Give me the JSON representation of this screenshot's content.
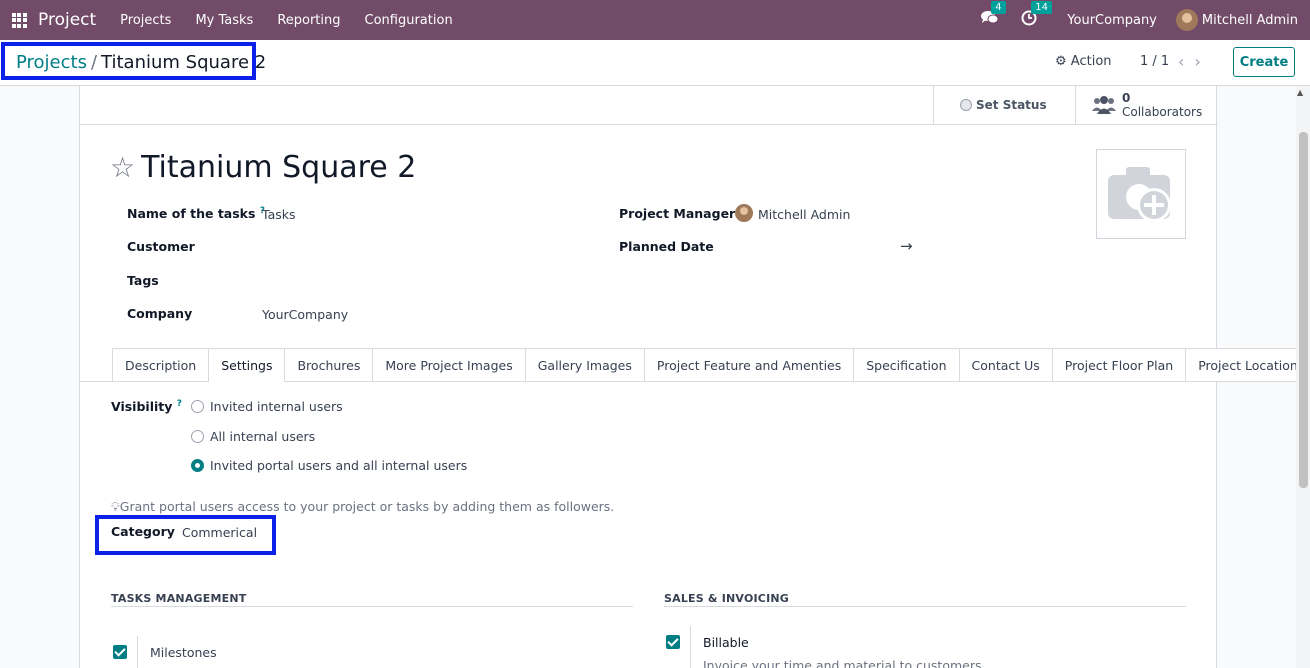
{
  "topbar": {
    "app_name": "Project",
    "menu": [
      "Projects",
      "My Tasks",
      "Reporting",
      "Configuration"
    ],
    "messages_count": "4",
    "activities_count": "14",
    "company": "YourCompany",
    "user": "Mitchell Admin"
  },
  "control": {
    "breadcrumb_parent": "Projects",
    "breadcrumb_sep": "/",
    "breadcrumb_current": "Titanium Square 2",
    "action_label": "Action",
    "pager": "1 / 1",
    "create_label": "Create"
  },
  "buttonbox": {
    "set_status": "Set Status",
    "collaborators_count": "0",
    "collaborators_label": "Collaborators"
  },
  "form": {
    "title": "Titanium Square 2",
    "name_of_tasks_label": "Name of the tasks",
    "name_of_tasks_value": "Tasks",
    "customer_label": "Customer",
    "tags_label": "Tags",
    "company_label": "Company",
    "company_value": "YourCompany",
    "project_manager_label": "Project Manager",
    "project_manager_value": "Mitchell Admin",
    "planned_date_label": "Planned Date",
    "planned_date_arrow": "→"
  },
  "tabs": [
    "Description",
    "Settings",
    "Brochures",
    "More Project Images",
    "Gallery Images",
    "Project Feature and Amenties",
    "Specification",
    "Contact Us",
    "Project Floor Plan",
    "Project Location Plan"
  ],
  "settings": {
    "visibility_label": "Visibility",
    "options": [
      "Invited internal users",
      "All internal users",
      "Invited portal users and all internal users"
    ],
    "hint": "Grant portal users access to your project or tasks by adding them as followers.",
    "category_label": "Category",
    "category_value": "Commerical",
    "tasks_management_title": "TASKS MANAGEMENT",
    "milestones_label": "Milestones",
    "sales_invoicing_title": "SALES & INVOICING",
    "billable_label": "Billable",
    "billable_desc": "Invoice your time and material to customers"
  },
  "colors": {
    "navbar": "#714b67",
    "accent": "#017e84",
    "highlight_box": "#0b21e8"
  }
}
